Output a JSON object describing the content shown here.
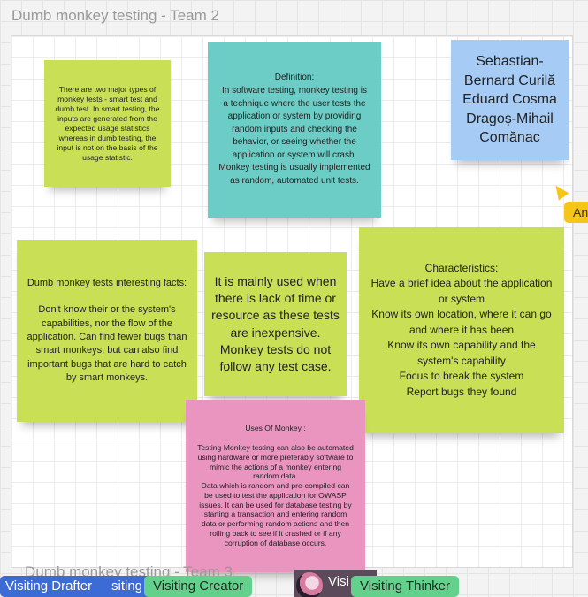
{
  "board": {
    "frame_title": "Dumb monkey testing - Team 2",
    "next_frame_title": "Dumb monkey testing - Team 3"
  },
  "notes": {
    "types": "There are two major types of monkey tests - smart test and dumb test. In smart testing, the inputs are generated from the expected usage statistics whereas in dumb testing, the input is not on the basis of the usage statistic.",
    "definition": "Definition:\nIn software testing, monkey testing is a technique where the user tests the application or system by providing random inputs and checking the behavior, or seeing whether the application or system will crash.\nMonkey testing is usually implemented as random, automated unit tests.",
    "authors": "Sebastian-Bernard Curilă\nEduard Cosma\nDragoș-Mihail Comănac",
    "facts": "Dumb monkey tests interesting facts:\n\nDon't know their or the system's capabilities, nor the flow of the application. Can find fewer bugs than smart monkeys, but can also find important bugs that are hard to catch by smart monkeys.",
    "usage": "It is mainly used when there is lack of time or resource as these tests are inexpensive.\nMonkey tests do not follow any test case.",
    "characteristics": "Characteristics:\nHave a brief idea about the application or system\nKnow its own location, where it can go and where it has been\nKnow its own capability and the system's capability\nFocus to break the system\nReport bugs they found",
    "uses": "Uses Of Monkey :\n\nTesting Monkey testing can also be automated using hardware or more preferably software to mimic the actions of a monkey entering random data.\nData which is random and pre-compiled can be used to test the application for OWASP issues. It can be used for database testing by starting a transaction and entering random data or performing random actions and then rolling back to see if it crashed or if any corruption of database occurs."
  },
  "collaborators": {
    "cursor_label": "An",
    "chip_drafter": "Visiting Drafter",
    "chip_partial": "siting",
    "chip_creator": "Visiting Creator",
    "chip_avatar_text": "Visi",
    "chip_thinker": "Visiting Thinker"
  },
  "colors": {
    "green_note": "#c9df56",
    "teal_note": "#6ccdc6",
    "blue_note": "#a6ccf5",
    "pink_note": "#ea94c0",
    "cursor": "#f5c518",
    "chip_blue": "#3d6bd6",
    "chip_green": "#63d18c"
  }
}
